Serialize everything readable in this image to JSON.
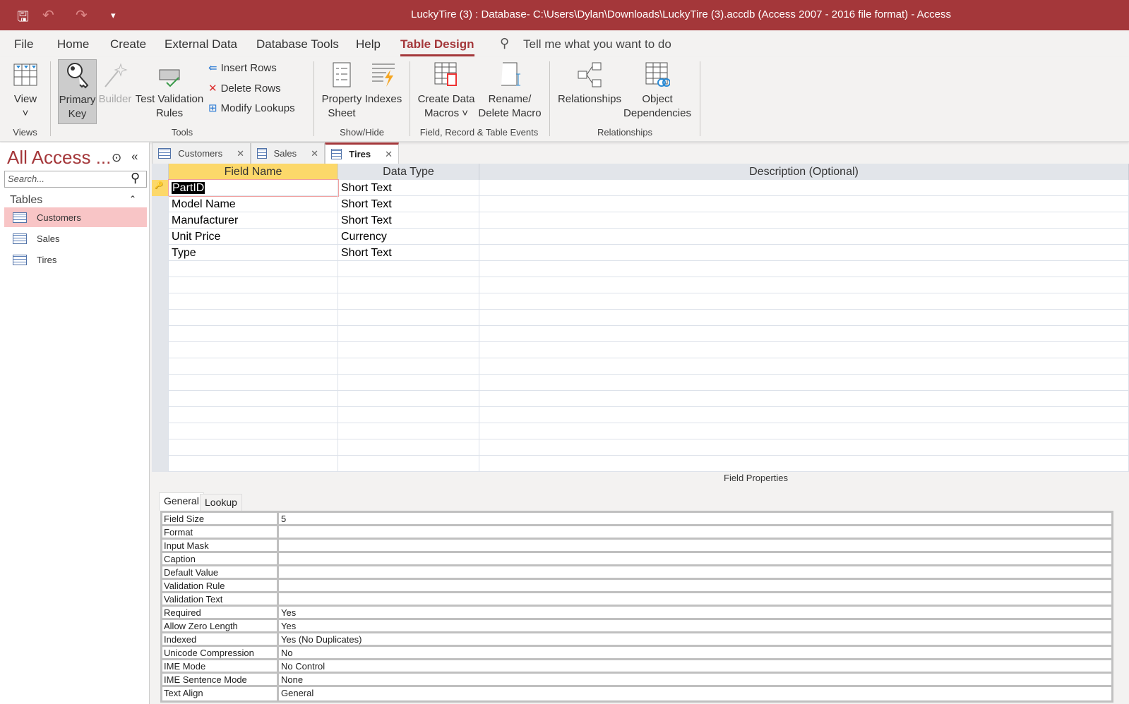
{
  "window": {
    "title": "LuckyTire (3) : Database- C:\\Users\\Dylan\\Downloads\\LuckyTire (3).accdb (Access 2007 - 2016 file format)  -  Access"
  },
  "menu": {
    "file": "File",
    "home": "Home",
    "create": "Create",
    "external": "External Data",
    "dbtools": "Database Tools",
    "help": "Help",
    "table_design": "Table Design",
    "tell_me": "Tell me what you want to do"
  },
  "ribbon": {
    "view": "View",
    "primary_key_1": "Primary",
    "primary_key_2": "Key",
    "builder": "Builder",
    "test_validation_1": "Test Validation",
    "test_validation_2": "Rules",
    "insert_rows": "Insert Rows",
    "delete_rows": "Delete Rows",
    "modify_lookups": "Modify Lookups",
    "property_sheet_1": "Property",
    "property_sheet_2": "Sheet",
    "indexes": "Indexes",
    "create_macros_1": "Create Data",
    "create_macros_2": "Macros ˅",
    "rename_macro_1": "Rename/",
    "rename_macro_2": "Delete Macro",
    "relationships": "Relationships",
    "object_dep_1": "Object",
    "object_dep_2": "Dependencies",
    "groups": {
      "views": "Views",
      "tools": "Tools",
      "showhide": "Show/Hide",
      "events": "Field, Record & Table Events",
      "relationships": "Relationships"
    }
  },
  "nav": {
    "title": "All Access ...",
    "search_placeholder": "Search...",
    "section": "Tables",
    "items": [
      {
        "label": "Customers"
      },
      {
        "label": "Sales"
      },
      {
        "label": "Tires"
      }
    ]
  },
  "doctabs": [
    {
      "label": "Customers"
    },
    {
      "label": "Sales"
    },
    {
      "label": "Tires"
    }
  ],
  "grid": {
    "headers": {
      "field": "Field Name",
      "type": "Data Type",
      "desc": "Description (Optional)"
    },
    "rows": [
      {
        "field": "PartID",
        "type": "Short Text"
      },
      {
        "field": "Model Name",
        "type": "Short Text"
      },
      {
        "field": "Manufacturer",
        "type": "Short Text"
      },
      {
        "field": "Unit Price",
        "type": "Currency"
      },
      {
        "field": "Type",
        "type": "Short Text"
      }
    ]
  },
  "field_properties": {
    "label": "Field Properties",
    "tabs": {
      "general": "General",
      "lookup": "Lookup"
    },
    "rows": [
      {
        "k": "Field Size",
        "v": "5"
      },
      {
        "k": "Format",
        "v": ""
      },
      {
        "k": "Input Mask",
        "v": ""
      },
      {
        "k": "Caption",
        "v": ""
      },
      {
        "k": "Default Value",
        "v": ""
      },
      {
        "k": "Validation Rule",
        "v": ""
      },
      {
        "k": "Validation Text",
        "v": ""
      },
      {
        "k": "Required",
        "v": "Yes"
      },
      {
        "k": "Allow Zero Length",
        "v": "Yes"
      },
      {
        "k": "Indexed",
        "v": "Yes (No Duplicates)"
      },
      {
        "k": "Unicode Compression",
        "v": "No"
      },
      {
        "k": "IME Mode",
        "v": "No Control"
      },
      {
        "k": "IME Sentence Mode",
        "v": "None"
      },
      {
        "k": "Text Align",
        "v": "General"
      }
    ]
  }
}
